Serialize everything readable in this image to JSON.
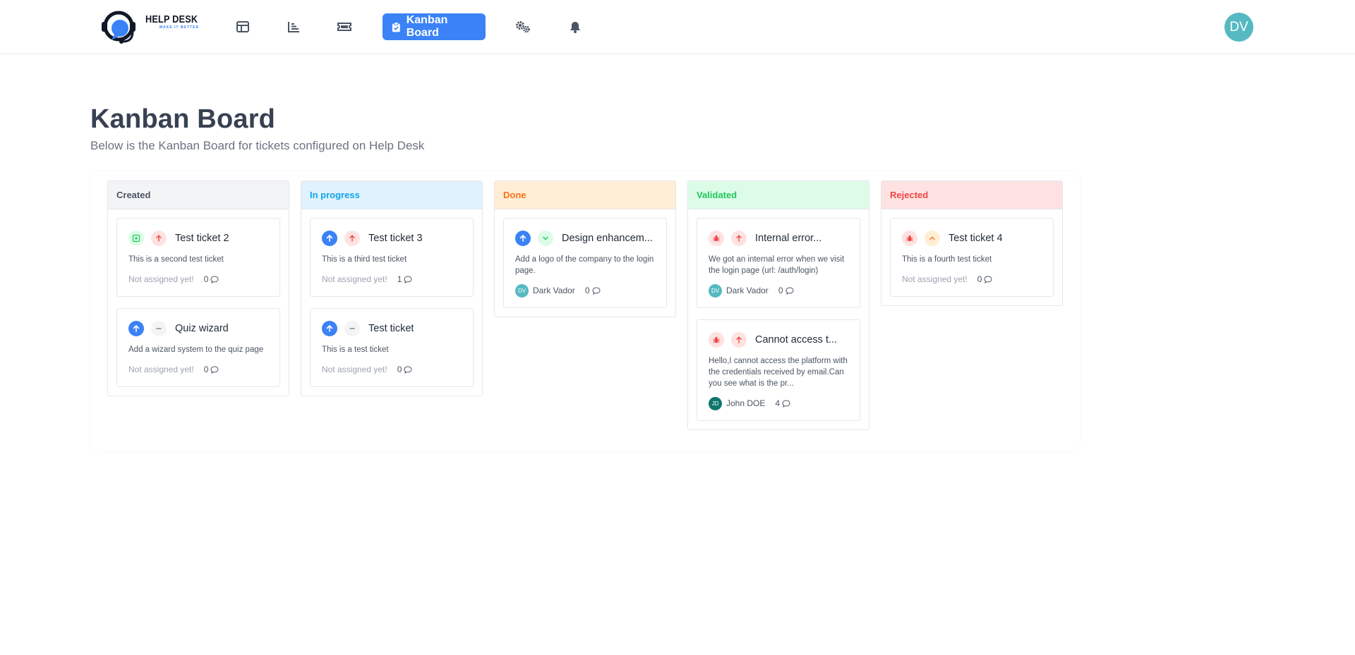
{
  "nav": {
    "logo": {
      "title": "HELP DESK",
      "tagline": "MAKE IT BETTER"
    },
    "items": [
      {
        "icon": "dashboard-icon"
      },
      {
        "icon": "analytics-icon"
      },
      {
        "icon": "tickets-icon"
      },
      {
        "icon": "clipboard-icon",
        "label": "Kanban Board",
        "active": true
      },
      {
        "icon": "gears-icon"
      },
      {
        "icon": "bell-icon"
      }
    ],
    "user_initials": "DV"
  },
  "page": {
    "title": "Kanban Board",
    "subtitle": "Below is the Kanban Board for tickets configured on Help Desk"
  },
  "columns": [
    {
      "title": "Created",
      "header_bg": "#f3f4f6",
      "header_color": "#4b5563",
      "cards": [
        {
          "type": "improvement",
          "priority": "high",
          "title": "Test ticket 2",
          "description": "This is a second test ticket",
          "assignee": "Not assigned yet!",
          "comments": "0"
        },
        {
          "type": "feature",
          "priority": "normal",
          "title": "Quiz wizard",
          "description": "Add a wizard system to the quiz page",
          "assignee": "Not assigned yet!",
          "comments": "0"
        }
      ]
    },
    {
      "title": "In progress",
      "header_bg": "#e0f2fe",
      "header_color": "#0ea5e9",
      "cards": [
        {
          "type": "feature",
          "priority": "high",
          "title": "Test ticket 3",
          "description": "This is a third test ticket",
          "assignee": "Not assigned yet!",
          "comments": "1"
        },
        {
          "type": "feature",
          "priority": "normal",
          "title": "Test ticket",
          "description": "This is a test ticket",
          "assignee": "Not assigned yet!",
          "comments": "0"
        }
      ]
    },
    {
      "title": "Done",
      "header_bg": "#ffedd5",
      "header_color": "#f97316",
      "cards": [
        {
          "type": "feature",
          "priority": "low",
          "title": "Design enhancem...",
          "description": "Add a logo of the company to the login page.",
          "assignee": "Dark Vador",
          "assignee_initials": "DV",
          "assignee_color": "#56b9c2",
          "comments": "0"
        }
      ]
    },
    {
      "title": "Validated",
      "header_bg": "#dcfce7",
      "header_color": "#22c55e",
      "cards": [
        {
          "type": "bug",
          "priority": "high",
          "title": "Internal error...",
          "description": "We got an internal error when we visit the login page (url: /auth/login)",
          "assignee": "Dark Vador",
          "assignee_initials": "DV",
          "assignee_color": "#56b9c2",
          "comments": "0"
        },
        {
          "type": "bug",
          "priority": "high",
          "title": "Cannot access t...",
          "description": "Hello,I cannot access the platform with the credentials received by email.Can you see what is the pr...",
          "assignee": "John DOE",
          "assignee_initials": "JD",
          "assignee_color": "#0f766e",
          "comments": "4"
        }
      ]
    },
    {
      "title": "Rejected",
      "header_bg": "#fee2e2",
      "header_color": "#ef4444",
      "cards": [
        {
          "type": "bug",
          "priority": "medium",
          "title": "Test ticket 4",
          "description": "This is a fourth test ticket",
          "assignee": "Not assigned yet!",
          "comments": "0"
        }
      ]
    }
  ]
}
